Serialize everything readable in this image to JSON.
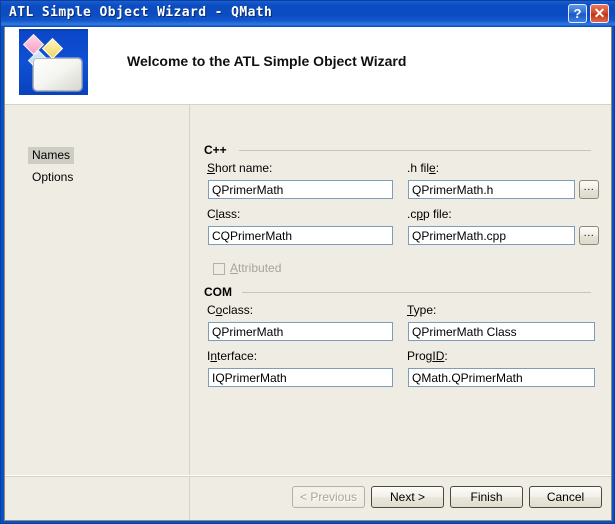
{
  "window": {
    "title": "ATL Simple Object Wizard - QMath",
    "help_button": "?",
    "close_button": "✕"
  },
  "banner": {
    "title": "Welcome to the ATL Simple Object Wizard",
    "icon": "wizard-banner-icon"
  },
  "sidebar": {
    "items": [
      {
        "label": "Names",
        "selected": true
      },
      {
        "label": "Options",
        "selected": false
      }
    ]
  },
  "groups": {
    "cpp": {
      "title": "C++",
      "fields": [
        {
          "label": "Short name:",
          "accel": "S",
          "value": "QPrimerMath"
        },
        {
          "label": ".h file:",
          "accel": "e",
          "value": "QPrimerMath.h",
          "browse": "..."
        },
        {
          "label": "Class:",
          "accel": "l",
          "value": "CQPrimerMath"
        },
        {
          "label": ".cpp file:",
          "accel": "p",
          "value": "QPrimerMath.cpp",
          "browse": "..."
        }
      ],
      "checkbox": {
        "label": "Attributed",
        "accel": "A",
        "checked": false,
        "enabled": false
      }
    },
    "com": {
      "title": "COM",
      "fields": [
        {
          "label": "Coclass:",
          "accel": "o",
          "value": "QPrimerMath"
        },
        {
          "label": "Type:",
          "accel": "T",
          "value": "QPrimerMath Class"
        },
        {
          "label": "Interface:",
          "accel": "n",
          "value": "IQPrimerMath"
        },
        {
          "label": "ProgID:",
          "accel": "D",
          "value": "QMath.QPrimerMath"
        }
      ]
    }
  },
  "footer": {
    "previous": "< Previous",
    "next": "Next >",
    "finish": "Finish",
    "cancel": "Cancel",
    "previous_enabled": false
  },
  "colors": {
    "titlebar_blue": "#0b4cc2",
    "dialog_background": "#efede3",
    "selection_gray": "#cdcdc3",
    "input_border": "#7f9db9",
    "disabled_text": "#a8a598",
    "close_red": "#bc3418"
  }
}
